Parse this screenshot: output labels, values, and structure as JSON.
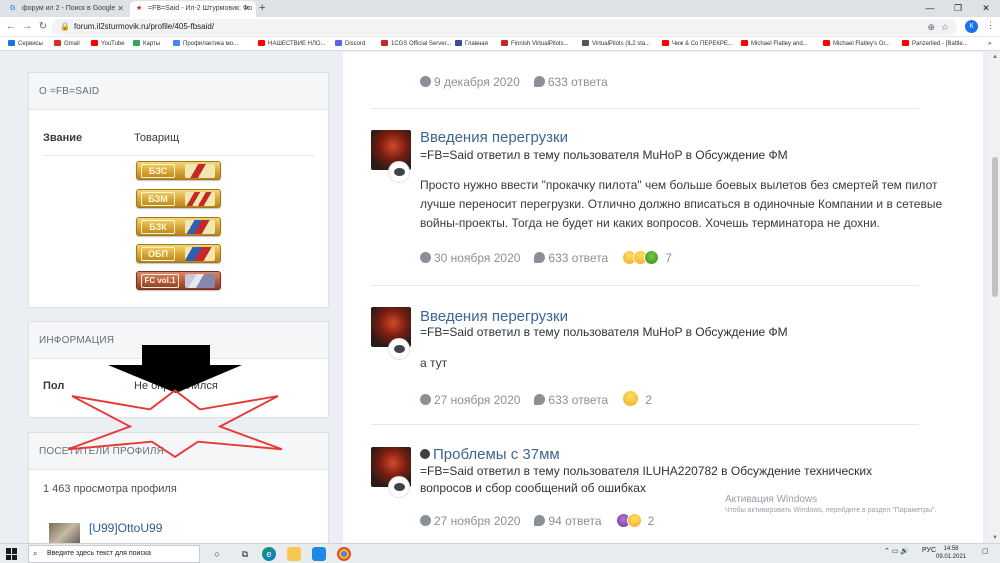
{
  "browser": {
    "tabs": [
      {
        "icon": "G",
        "label": "форум ил 2 - Поиск в Google"
      },
      {
        "icon": "★",
        "label": "=FB=Said - Ил-2 Штурмовик: Фо"
      }
    ],
    "new_tab": "+",
    "url": "forum.il2sturmovik.ru/profile/405-fbsaid/",
    "profile_initial": "К",
    "bookmarks": [
      "Сервисы",
      "Gmail",
      "YouTube",
      "Карты",
      "Профилактика мо...",
      "НАШЕСТВИЕ НЛО...",
      "Discord",
      "1CGS Official Server...",
      "Главная",
      "Finnish VirtualPilots...",
      "VirtualPilots (IL2 sta...",
      "Чиж & Co ПЕРЕКРЕ...",
      "Michael Flatley and...",
      "Michael Flatley's Gr...",
      "Panzerlied - [Battle..."
    ],
    "bookmark_colors": [
      "#1a73e8",
      "#d93025",
      "#ff0000",
      "#34a853",
      "#4285f4",
      "#ff0000",
      "#5865f2",
      "#c62828",
      "#3949ab",
      "#c62828",
      "#555555",
      "#ff0000",
      "#ff0000",
      "#ff0000",
      "#ff0000"
    ]
  },
  "sidebar": {
    "about": {
      "title": "О =FB=SAID",
      "rank_label": "Звание",
      "rank_value": "Товарищ",
      "ribbons": [
        "БЗС",
        "БЗМ",
        "БЗК",
        "ОБП",
        "FC vol.1"
      ]
    },
    "info": {
      "title": "ИНФОРМАЦИЯ",
      "gender_label": "Пол",
      "gender_value": "Не определился"
    },
    "visitors": {
      "title": "ПОСЕТИТЕЛИ ПРОФИЛЯ",
      "views": "1 463 просмотра профиля",
      "first_visitor": "[U99]OttoU99"
    }
  },
  "stream": {
    "items": [
      {
        "date": "9 декабря 2020",
        "replies": "633 ответа"
      },
      {
        "title": "Введения перегрузки",
        "subtitle": "=FB=Said ответил в тему пользователя MuHoP в Обсуждение ФМ",
        "body": "Просто нужно ввести \"прокачку пилота\" чем больше боевых вылетов без смертей тем пилот лучше переносит перегрузки. Отлично должно вписаться в одиночные Компании и в сетевые войны-проекты. Тогда не будет ни каких вопросов. Хочешь терминатора не дохни.",
        "date": "30 ноября 2020",
        "replies": "633 ответа",
        "reactions": "7"
      },
      {
        "title": "Введения перегрузки",
        "subtitle": "=FB=Said ответил в тему пользователя MuHoP в Обсуждение ФМ",
        "body": "а тут",
        "date": "27 ноября 2020",
        "replies": "633 ответа",
        "reactions": "2"
      },
      {
        "title": "Проблемы с 37мм",
        "subtitle": "=FB=Said ответил в тему пользователя ILUHA220782 в Обсуждение технических вопросов и сбор сообщений об ошибках",
        "date": "27 ноября 2020",
        "replies": "94 ответа",
        "reactions": "2"
      }
    ]
  },
  "watermark": {
    "title": "Активация Windows",
    "text": "Чтобы активировать Windows, перейдите в раздел \"Параметры\"."
  },
  "taskbar": {
    "search_placeholder": "Введите здесь текст для поиска",
    "lang": "РУС",
    "time": "14:58",
    "date": "09.01.2021"
  },
  "colors": {
    "link": "#3d6594",
    "meta": "#8a9098",
    "overlay_star": "#e53935",
    "overlay_arrow": "#000000"
  }
}
